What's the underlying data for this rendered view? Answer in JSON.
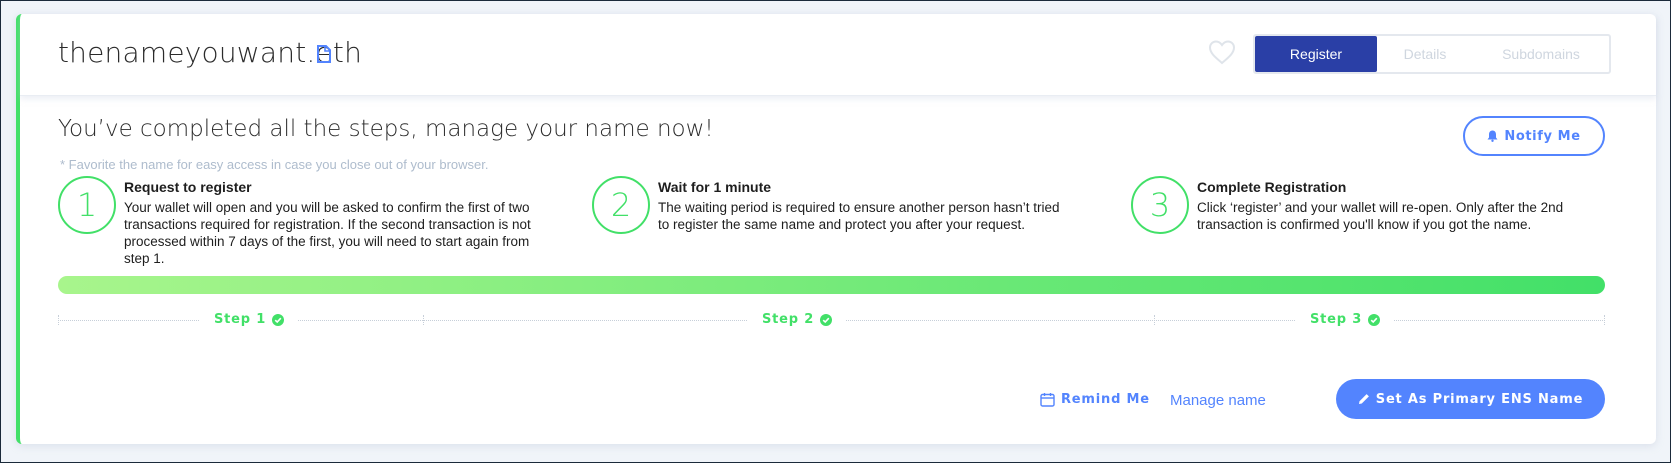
{
  "header": {
    "domain": "thenameyouwant.eth",
    "tabs": [
      {
        "label": "Register",
        "active": true
      },
      {
        "label": "Details",
        "active": false
      },
      {
        "label": "Subdomains",
        "active": false
      }
    ],
    "icons": {
      "copy": "copy-icon",
      "favorite": "heart-icon"
    }
  },
  "main": {
    "headline": "You’ve completed all the steps, manage your name now!",
    "note": "* Favorite the name for easy access in case you close out of your browser.",
    "notify_label": "Notify Me",
    "steps": [
      {
        "number": "1",
        "title": "Request to register",
        "description": "Your wallet will open and you will be asked to confirm the first of two transactions required for registration. If the second transaction is not processed within 7 days of the first, you will need to start again from step 1."
      },
      {
        "number": "2",
        "title": "Wait for 1 minute",
        "description": "The waiting period is required to ensure another person hasn’t tried to register the same name and protect you after your request."
      },
      {
        "number": "3",
        "title": "Complete Registration",
        "description": "Click ‘register’ and your wallet will re-open. Only after the 2nd transaction is confirmed you'll know if you got the name."
      }
    ],
    "progress": 1.0,
    "step_labels": [
      "Step 1",
      "Step 2",
      "Step 3"
    ]
  },
  "actions": {
    "remind_label": "Remind Me",
    "manage_label": "Manage name",
    "primary_label": "Set As Primary ENS Name"
  },
  "colors": {
    "accent_green": "#42e068",
    "accent_blue": "#5384fe",
    "tab_active": "#2a3fa6"
  }
}
